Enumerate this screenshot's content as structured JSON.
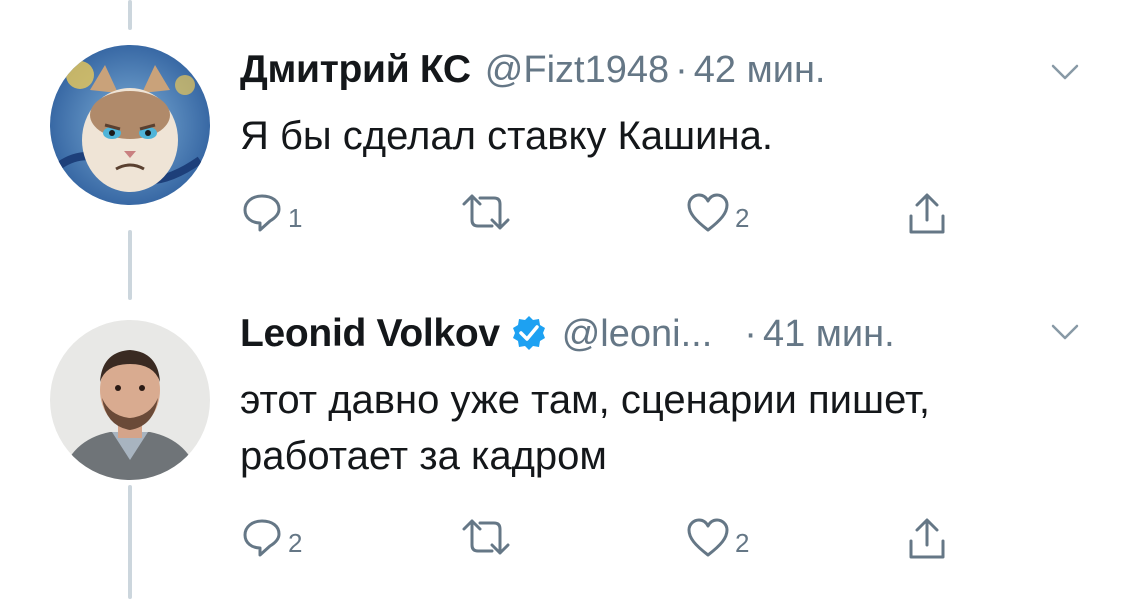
{
  "tweets": [
    {
      "name": "Дмитрий КС",
      "handle": "@Fizt1948",
      "time": "42 мин.",
      "text": "Я бы сделал ставку Кашина.",
      "verified": false,
      "reply_count": "1",
      "retweet_count": "",
      "like_count": "2",
      "avatar_icon": "grumpy-cat-avatar"
    },
    {
      "name": "Leonid Volkov",
      "handle": "@leoni...",
      "time": "41 мин.",
      "text": "этот давно уже там, сценарии пишет, работает за кадром",
      "verified": true,
      "reply_count": "2",
      "retweet_count": "",
      "like_count": "2",
      "avatar_icon": "person-avatar"
    }
  ],
  "separator": "·",
  "colors": {
    "text": "#14171a",
    "secondary": "#657786",
    "verified_blue": "#1da1f2",
    "thread_line": "#ccd6dd"
  }
}
